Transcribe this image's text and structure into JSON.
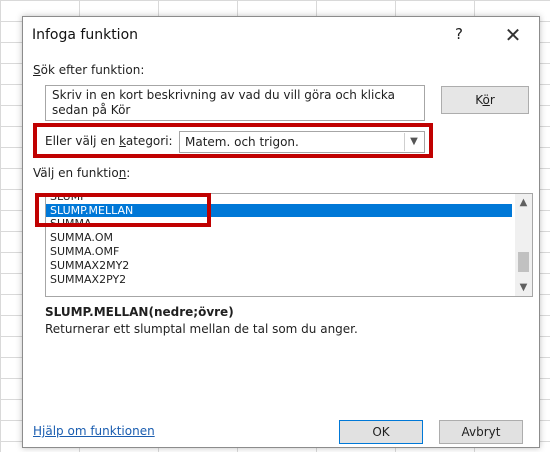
{
  "dialog": {
    "title": "Infoga funktion",
    "help_symbol": "?",
    "close_symbol": "✕"
  },
  "search": {
    "label_prefix": "",
    "label_mnemonic": "S",
    "label_rest": "ök efter funktion:",
    "value": "Skriv in en kort beskrivning av vad du vill göra och klicka\nsedan på Kör",
    "go_label_pre": "K",
    "go_label_mnemonic": "ö",
    "go_label_post": "r"
  },
  "category": {
    "label_pre": "Eller välj en ",
    "label_mnemonic": "k",
    "label_post": "ategori:",
    "selected": "Matem. och trigon."
  },
  "function_list": {
    "label_pre": "Välj en funktio",
    "label_mnemonic": "n",
    "label_post": ":",
    "items": [
      "SLUMP",
      "SLUMP.MELLAN",
      "SUMMA",
      "SUMMA.OM",
      "SUMMA.OMF",
      "SUMMAX2MY2",
      "SUMMAX2PY2"
    ],
    "selected_index": 1
  },
  "details": {
    "signature": "SLUMP.MELLAN(nedre;övre)",
    "description": "Returnerar ett slumptal mellan de tal som du anger."
  },
  "footer": {
    "help_link": "Hjälp om funktionen",
    "ok_label": "OK",
    "cancel_label": "Avbryt"
  },
  "colors": {
    "selection": "#0078d7",
    "highlight_box": "#c00000",
    "link": "#1a5db0"
  },
  "icons": {
    "dropdown": "chevron-down-icon",
    "scroll_up": "chevron-up-icon",
    "scroll_down": "chevron-down-icon",
    "close": "close-icon",
    "help": "help-icon"
  }
}
